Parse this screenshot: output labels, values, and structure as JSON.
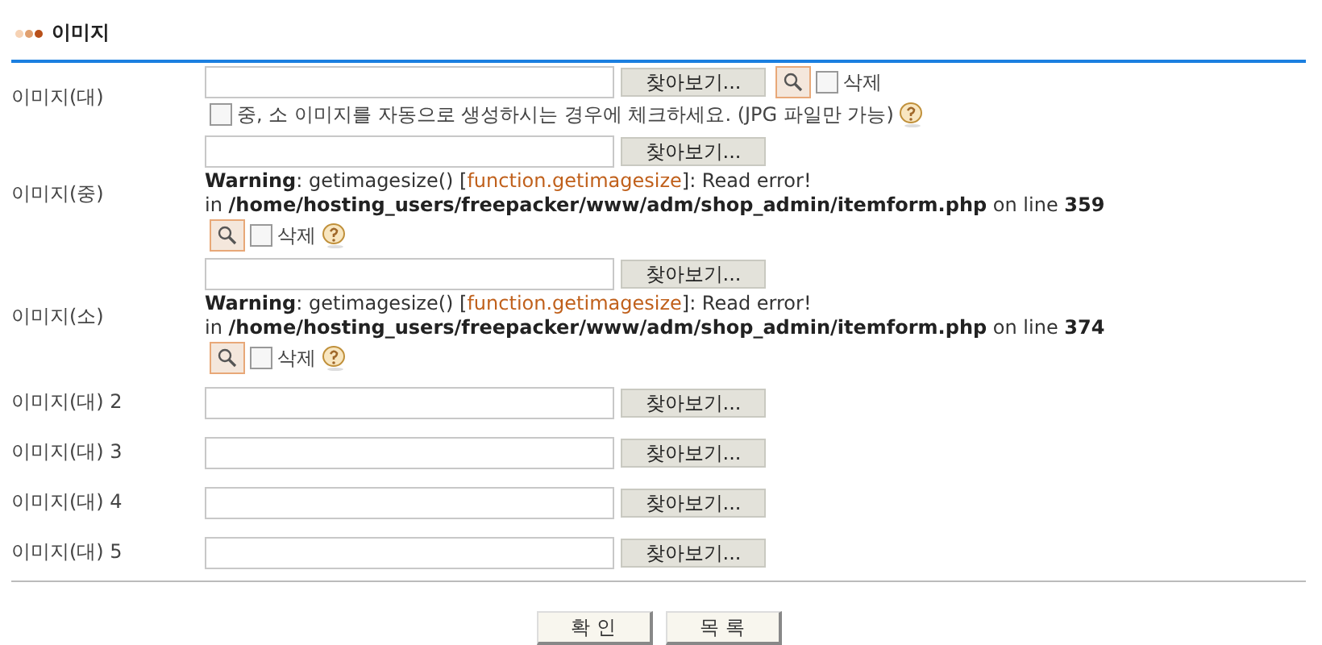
{
  "section": {
    "title": "이미지"
  },
  "rows": [
    {
      "label": "이미지(대)",
      "lines": [
        {
          "parts": [
            {
              "kind": "field"
            },
            {
              "kind": "browse",
              "label": "찾아보기..."
            },
            {
              "kind": "preview"
            },
            {
              "kind": "checkbox",
              "label": "삭제",
              "checked": false
            }
          ]
        },
        {
          "parts": [
            {
              "kind": "checkbox",
              "label": "중, 소 이미지를 자동으로 생성하시는 경우에 체크하세요. (JPG 파일만 가능)",
              "checked": false
            },
            {
              "kind": "help"
            }
          ]
        }
      ]
    },
    {
      "label": "이미지(중)",
      "lines": [
        {
          "parts": [
            {
              "kind": "field"
            },
            {
              "kind": "browse",
              "label": "찾아보기..."
            }
          ]
        },
        {
          "parts": [
            {
              "kind": "warning",
              "label": "Warning",
              "text1": ": getimagesize() [",
              "link": "function.getimagesize",
              "text2": "]: Read error!",
              "text3": "in ",
              "path": "/home/hosting_users/freepacker/www/adm/shop_admin/itemform.php",
              "text4": " on line ",
              "line": "359"
            }
          ]
        },
        {
          "parts": [
            {
              "kind": "preview"
            },
            {
              "kind": "checkbox",
              "label": "삭제",
              "checked": false
            },
            {
              "kind": "help"
            }
          ]
        }
      ]
    },
    {
      "label": "이미지(소)",
      "lines": [
        {
          "parts": [
            {
              "kind": "field"
            },
            {
              "kind": "browse",
              "label": "찾아보기..."
            }
          ]
        },
        {
          "parts": [
            {
              "kind": "warning",
              "label": "Warning",
              "text1": ": getimagesize() [",
              "link": "function.getimagesize",
              "text2": "]: Read error!",
              "text3": "in ",
              "path": "/home/hosting_users/freepacker/www/adm/shop_admin/itemform.php",
              "text4": " on line ",
              "line": "374"
            }
          ]
        },
        {
          "parts": [
            {
              "kind": "preview"
            },
            {
              "kind": "checkbox",
              "label": "삭제",
              "checked": false
            },
            {
              "kind": "help"
            }
          ]
        }
      ]
    },
    {
      "label": "이미지(대) 2",
      "lines": [
        {
          "parts": [
            {
              "kind": "field"
            },
            {
              "kind": "browse",
              "label": "찾아보기..."
            }
          ]
        }
      ]
    },
    {
      "label": "이미지(대) 3",
      "lines": [
        {
          "parts": [
            {
              "kind": "field"
            },
            {
              "kind": "browse",
              "label": "찾아보기..."
            }
          ]
        }
      ]
    },
    {
      "label": "이미지(대) 4",
      "lines": [
        {
          "parts": [
            {
              "kind": "field"
            },
            {
              "kind": "browse",
              "label": "찾아보기..."
            }
          ]
        }
      ]
    },
    {
      "label": "이미지(대) 5",
      "lines": [
        {
          "parts": [
            {
              "kind": "field"
            },
            {
              "kind": "browse",
              "label": "찾아보기..."
            }
          ]
        }
      ]
    }
  ],
  "buttons": [
    "확 인",
    "목 록"
  ]
}
